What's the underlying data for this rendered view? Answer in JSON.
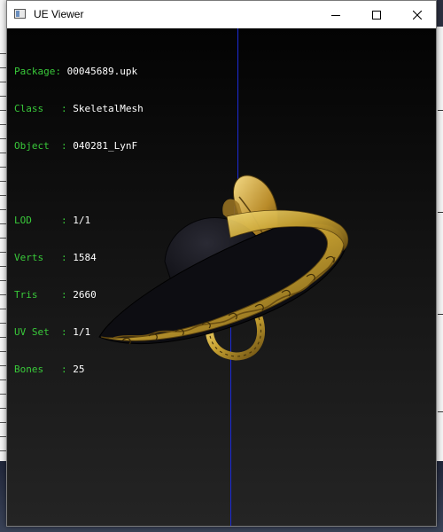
{
  "window": {
    "title": "UE Viewer",
    "buttons": [
      "minimize",
      "maximize",
      "close"
    ]
  },
  "info": {
    "rows": [
      {
        "label": "Package: ",
        "value": "00045689.upk"
      },
      {
        "label": "Class   : ",
        "value": "SkeletalMesh"
      },
      {
        "label": "Object  : ",
        "value": "040281_LynF"
      }
    ],
    "stats": [
      {
        "label": "LOD     : ",
        "value": "1/1"
      },
      {
        "label": "Verts   : ",
        "value": "1584"
      },
      {
        "label": "Tris    : ",
        "value": "2660"
      },
      {
        "label": "UV Set  : ",
        "value": "1/1"
      },
      {
        "label": "Bones   : ",
        "value": "25"
      }
    ]
  },
  "colors": {
    "label_green": "#39c93a",
    "value_white": "#ffffff",
    "axis_blue": "#1c2bd8",
    "hat_gold": "#c9a332"
  },
  "model": {
    "name": "sombrero-hat-mesh"
  }
}
